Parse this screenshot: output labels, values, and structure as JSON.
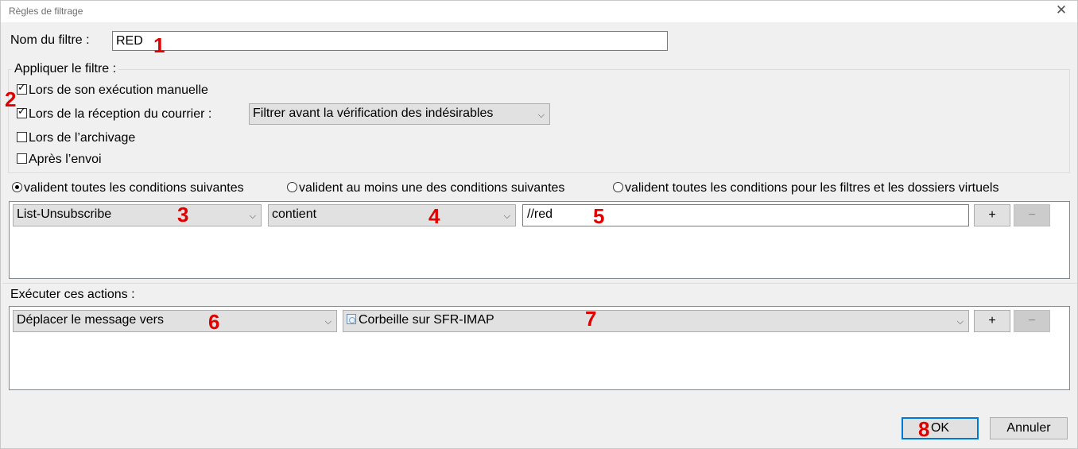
{
  "window": {
    "title": "Règles de filtrage",
    "close_glyph": "✕"
  },
  "filter_name": {
    "label": "Nom du filtre :",
    "value": "RED"
  },
  "apply": {
    "legend": "Appliquer le filtre :",
    "options": [
      {
        "label": "Lors de son exécution manuelle",
        "checked": true
      },
      {
        "label": "Lors de la réception du courrier :",
        "checked": true
      },
      {
        "label": "Lors de l’archivage",
        "checked": false
      },
      {
        "label": "Après l’envoi",
        "checked": false
      }
    ],
    "reception_mode": "Filtrer avant la vérification des indésirables"
  },
  "match_mode": {
    "options": [
      {
        "label": "valident toutes les conditions suivantes",
        "selected": true
      },
      {
        "label": "valident au moins une des conditions suivantes",
        "selected": false
      },
      {
        "label": "valident toutes les conditions pour les filtres et les dossiers virtuels",
        "selected": false
      }
    ]
  },
  "condition": {
    "field": "List-Unsubscribe",
    "operator": "contient",
    "value": "//red",
    "add_label": "+",
    "remove_label": "−"
  },
  "actions": {
    "label": "Exécuter ces actions :",
    "action": "Déplacer le message vers",
    "target": "Corbeille sur SFR-IMAP",
    "target_icon": "trash-folder-icon",
    "add_label": "+",
    "remove_label": "−"
  },
  "buttons": {
    "ok": "OK",
    "cancel": "Annuler"
  },
  "annotations": [
    "1",
    "2",
    "3",
    "4",
    "5",
    "6",
    "7",
    "8"
  ],
  "colors": {
    "annotation": "#e00000",
    "default_button_border": "#0078d7"
  }
}
